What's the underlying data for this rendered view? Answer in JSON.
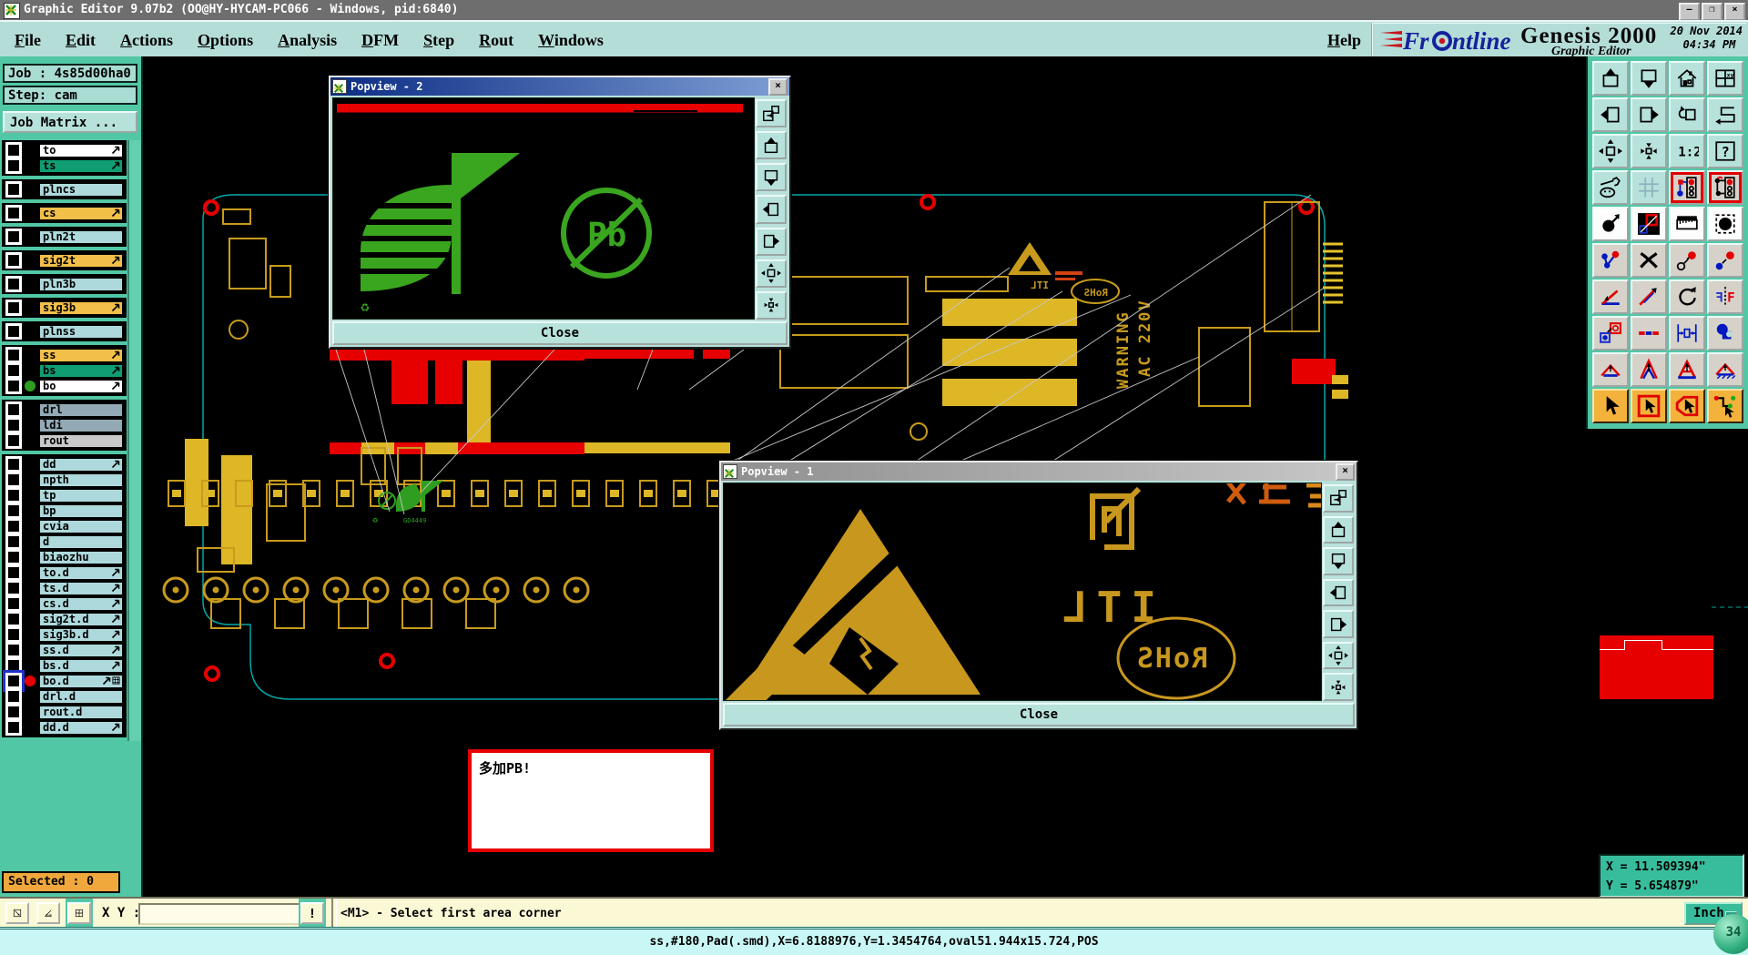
{
  "titlebar": {
    "title": "Graphic Editor 9.07b2 (OO@HY-HYCAM-PC066 - Windows, pid:6840)",
    "minimize": "—",
    "maximize": "❐",
    "close": "×"
  },
  "menubar": {
    "items": [
      "File",
      "Edit",
      "Actions",
      "Options",
      "Analysis",
      "DFM",
      "Step",
      "Rout",
      "Windows"
    ],
    "help": "Help"
  },
  "brand": {
    "name": "Frontline",
    "product": "Genesis 2000",
    "date": "20 Nov 2014",
    "time": "04:34 PM",
    "subtitle": "Graphic Editor"
  },
  "job": {
    "job_label": "Job : 4s85d00ha0",
    "step_label": "Step: cam",
    "matrix_button": "Job Matrix ...",
    "selected": "Selected : 0"
  },
  "sidebar": {
    "group_sizes": [
      2,
      1,
      1,
      1,
      1,
      1,
      1,
      1,
      3,
      3,
      18
    ]
  },
  "layers": [
    {
      "name": "to",
      "color": "white",
      "arrow": true
    },
    {
      "name": "ts",
      "color": "green",
      "arrow": true
    },
    {
      "name": "plncs",
      "color": "blue",
      "arrow": false
    },
    {
      "name": "cs",
      "color": "orange",
      "arrow": true
    },
    {
      "name": "pln2t",
      "color": "blue",
      "arrow": false
    },
    {
      "name": "sig2t",
      "color": "orange",
      "arrow": true
    },
    {
      "name": "pln3b",
      "color": "blue",
      "arrow": false
    },
    {
      "name": "sig3b",
      "color": "orange",
      "arrow": true
    },
    {
      "name": "plnss",
      "color": "blue",
      "arrow": false
    },
    {
      "name": "ss",
      "color": "orange",
      "arrow": true
    },
    {
      "name": "bs",
      "color": "green",
      "arrow": true
    },
    {
      "name": "bo",
      "color": "white",
      "arrow": true,
      "dot": "#2f9e20"
    },
    {
      "name": "drl",
      "color": "slate",
      "arrow": false
    },
    {
      "name": "ldi",
      "color": "slate",
      "arrow": false
    },
    {
      "name": "rout",
      "color": "gray",
      "arrow": false
    },
    {
      "name": "dd",
      "color": "blue",
      "arrow": true
    },
    {
      "name": "npth",
      "color": "blue",
      "arrow": false
    },
    {
      "name": "tp",
      "color": "blue",
      "arrow": false
    },
    {
      "name": "bp",
      "color": "blue",
      "arrow": false
    },
    {
      "name": "cvia",
      "color": "blue",
      "arrow": false
    },
    {
      "name": "d",
      "color": "blue",
      "arrow": false
    },
    {
      "name": "biaozhu",
      "color": "blue",
      "arrow": false
    },
    {
      "name": "to.d",
      "color": "blue",
      "arrow": true
    },
    {
      "name": "ts.d",
      "color": "blue",
      "arrow": true
    },
    {
      "name": "cs.d",
      "color": "blue",
      "arrow": true
    },
    {
      "name": "sig2t.d",
      "color": "blue",
      "arrow": true
    },
    {
      "name": "sig3b.d",
      "color": "blue",
      "arrow": true
    },
    {
      "name": "ss.d",
      "color": "blue",
      "arrow": true
    },
    {
      "name": "bs.d",
      "color": "blue",
      "arrow": true
    },
    {
      "name": "bo.d",
      "color": "blue",
      "arrow": true,
      "dot": "#e60000",
      "extra": "grid",
      "selected": true
    },
    {
      "name": "drl.d",
      "color": "blue",
      "arrow": false
    },
    {
      "name": "rout.d",
      "color": "blue",
      "arrow": false
    },
    {
      "name": "dd.d",
      "color": "blue",
      "arrow": true
    }
  ],
  "toolbar": {
    "buttons": [
      {
        "name": "pan-up",
        "icon": "panup",
        "bg": "teal"
      },
      {
        "name": "pan-down",
        "icon": "pandown",
        "bg": "teal"
      },
      {
        "name": "zoom-home",
        "icon": "home",
        "bg": "teal"
      },
      {
        "name": "split-window-xy",
        "icon": "winxy",
        "bg": "teal"
      },
      {
        "name": "pan-left",
        "icon": "panleft",
        "bg": "teal"
      },
      {
        "name": "pan-right",
        "icon": "panright",
        "bg": "teal"
      },
      {
        "name": "zoom-previous",
        "icon": "prevview",
        "bg": "teal"
      },
      {
        "name": "serpentine-route",
        "icon": "sroute",
        "bg": "teal"
      },
      {
        "name": "zoom-fit",
        "icon": "zoomfit",
        "bg": "teal"
      },
      {
        "name": "zoom-out",
        "icon": "zoomout",
        "bg": "teal"
      },
      {
        "name": "zoom-1-2",
        "icon": "onetwo",
        "bg": "teal"
      },
      {
        "name": "help-query",
        "icon": "query",
        "bg": "teal"
      },
      {
        "name": "setup-tools",
        "icon": "tools",
        "bg": "teal"
      },
      {
        "name": "snap-grid",
        "icon": "grid",
        "bg": "teal"
      },
      {
        "name": "net-view-a",
        "icon": "neta",
        "bg": "red"
      },
      {
        "name": "net-view-b",
        "icon": "netb",
        "bg": "red"
      },
      {
        "name": "move-object",
        "icon": "move",
        "bg": "white"
      },
      {
        "name": "copy-to-layer",
        "icon": "copydark",
        "bg": "white"
      },
      {
        "name": "measure-ruler",
        "icon": "ruler",
        "bg": "white"
      },
      {
        "name": "select-pad",
        "icon": "selpad",
        "bg": "white"
      },
      {
        "name": "chain-select",
        "icon": "chain",
        "bg": "gray"
      },
      {
        "name": "delete-object",
        "icon": "delx",
        "bg": "gray"
      },
      {
        "name": "change-symbol",
        "icon": "chgsym",
        "bg": "gray"
      },
      {
        "name": "move-vertex",
        "icon": "movevtx",
        "bg": "gray"
      },
      {
        "name": "measure-angle",
        "icon": "angle",
        "bg": "gray"
      },
      {
        "name": "measure-distance",
        "icon": "slope",
        "bg": "gray"
      },
      {
        "name": "rotate-object",
        "icon": "rotate",
        "bg": "gray"
      },
      {
        "name": "mirror-object",
        "icon": "mirror",
        "bg": "gray"
      },
      {
        "name": "copy-pad",
        "icon": "copypad",
        "bg": "gray"
      },
      {
        "name": "stretch-line",
        "icon": "stretch",
        "bg": "gray"
      },
      {
        "name": "measure-gap",
        "icon": "gap",
        "bg": "gray"
      },
      {
        "name": "create-surface",
        "icon": "surface",
        "bg": "gray"
      },
      {
        "name": "contour-a",
        "icon": "tria",
        "bg": "gray"
      },
      {
        "name": "contour-b",
        "icon": "trib",
        "bg": "gray"
      },
      {
        "name": "contour-c",
        "icon": "tric",
        "bg": "gray"
      },
      {
        "name": "contour-d",
        "icon": "trid",
        "bg": "gray"
      },
      {
        "name": "select-cursor",
        "icon": "cursor",
        "bg": "orange"
      },
      {
        "name": "select-frame",
        "icon": "cursorframe",
        "bg": "orange"
      },
      {
        "name": "select-polygon",
        "icon": "cursorpoly",
        "bg": "orange"
      },
      {
        "name": "route-mode",
        "icon": "routecursor",
        "bg": "orange"
      }
    ]
  },
  "popview_buttons": [
    {
      "name": "detach-view",
      "icon": "wincopy"
    },
    {
      "name": "pan-up",
      "icon": "panup"
    },
    {
      "name": "pan-down",
      "icon": "pandown"
    },
    {
      "name": "pan-left",
      "icon": "panleft"
    },
    {
      "name": "pan-right",
      "icon": "panright"
    },
    {
      "name": "zoom-fit",
      "icon": "zoomfit"
    },
    {
      "name": "zoom-out",
      "icon": "zoomout"
    }
  ],
  "popview2": {
    "title": "Popview - 2",
    "close": "Close"
  },
  "popview1": {
    "title": "Popview - 1",
    "close": "Close"
  },
  "canvas_note": {
    "text": "多加PB!"
  },
  "silkscreen": {
    "rohs": "RoHS",
    "itl": "ITL",
    "warning_big": "RNING",
    "warning_voltage": "220V",
    "warning_small_1": "WARNING",
    "warning_small_2": "AC 220V",
    "pb": "Pb",
    "recycle": "♻",
    "green_code": "GD4449"
  },
  "statusbar": {
    "xy_label": "X Y :",
    "xy_value": "",
    "bang": "!",
    "message": "<M1> - Select first area corner",
    "units": "Inch",
    "badge": "34"
  },
  "coords": {
    "x": "X = 11.509394\"",
    "y": "Y = 5.654879\""
  },
  "infobar": {
    "text": "ss,#180,Pad(.smd),X=6.8188976,Y=1.3454764,oval51.944x15.724,POS"
  }
}
